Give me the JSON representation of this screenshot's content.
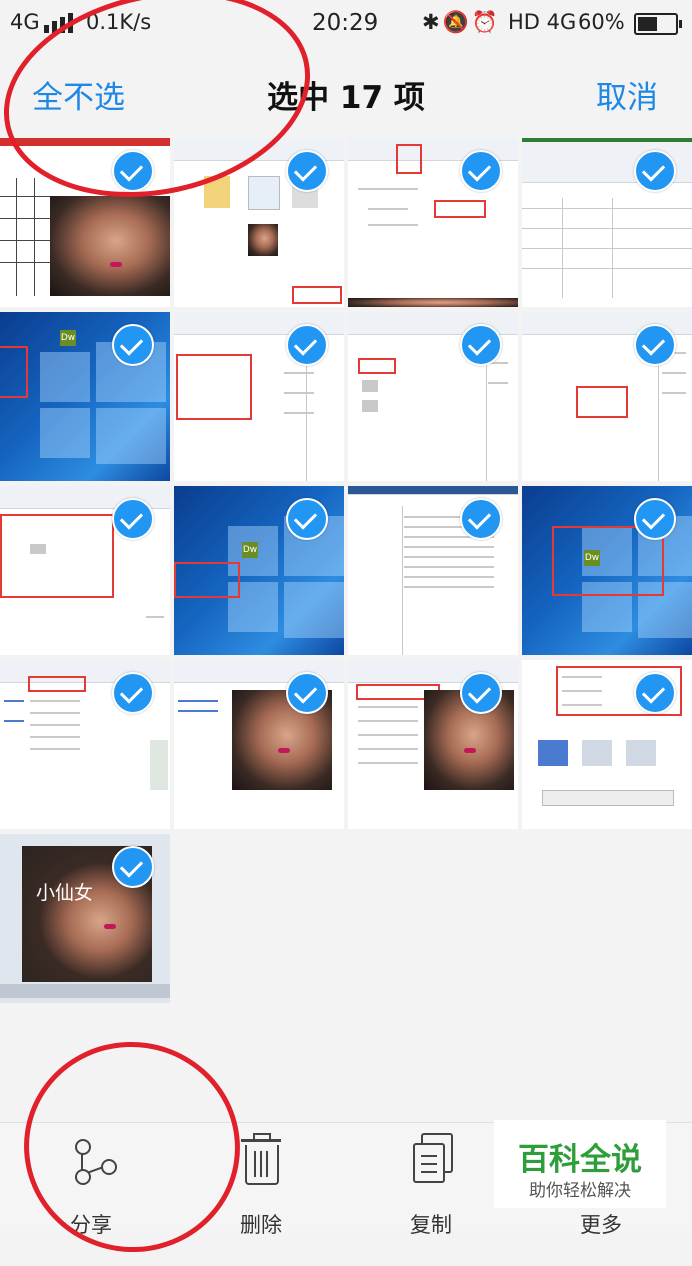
{
  "status_bar": {
    "network": "4G",
    "speed": "0.1K/s",
    "time": "20:29",
    "icons": [
      "bluetooth-icon",
      "mute-icon",
      "alarm-icon"
    ],
    "hd_network": "HD 4G",
    "battery_percent": "60%",
    "battery_level": 0.6
  },
  "header": {
    "select_none": "全不选",
    "title": "选中 17 项",
    "cancel": "取消"
  },
  "grid": {
    "selected_count": 17,
    "tiles": [
      {
        "kind": "excel-photo",
        "selected": true
      },
      {
        "kind": "file-explorer",
        "selected": true
      },
      {
        "kind": "word-insert-dialog",
        "selected": true
      },
      {
        "kind": "excel-blank",
        "selected": true
      },
      {
        "kind": "windows-desktop",
        "selected": true
      },
      {
        "kind": "word-document",
        "selected": true
      },
      {
        "kind": "word-document",
        "selected": true
      },
      {
        "kind": "word-document",
        "selected": true
      },
      {
        "kind": "word-dialog",
        "selected": true
      },
      {
        "kind": "windows-desktop",
        "selected": true
      },
      {
        "kind": "word-text",
        "selected": true
      },
      {
        "kind": "windows-desktop",
        "selected": true
      },
      {
        "kind": "editor-menu",
        "selected": true
      },
      {
        "kind": "editor-photo",
        "selected": true
      },
      {
        "kind": "editor-menu-photo",
        "selected": true
      },
      {
        "kind": "properties-dialog",
        "selected": true
      },
      {
        "kind": "editor-photo-text",
        "selected": true,
        "label": "小仙女"
      }
    ]
  },
  "bottom_bar": {
    "share": "分享",
    "delete": "删除",
    "copy": "复制",
    "more": "更多"
  },
  "watermark": {
    "title": "百科全说",
    "subtitle": "助你轻松解决"
  },
  "colors": {
    "accent": "#1e88e5",
    "check": "#2196f3",
    "annotation": "#e0202a",
    "watermark_green": "#2e9e3a"
  }
}
